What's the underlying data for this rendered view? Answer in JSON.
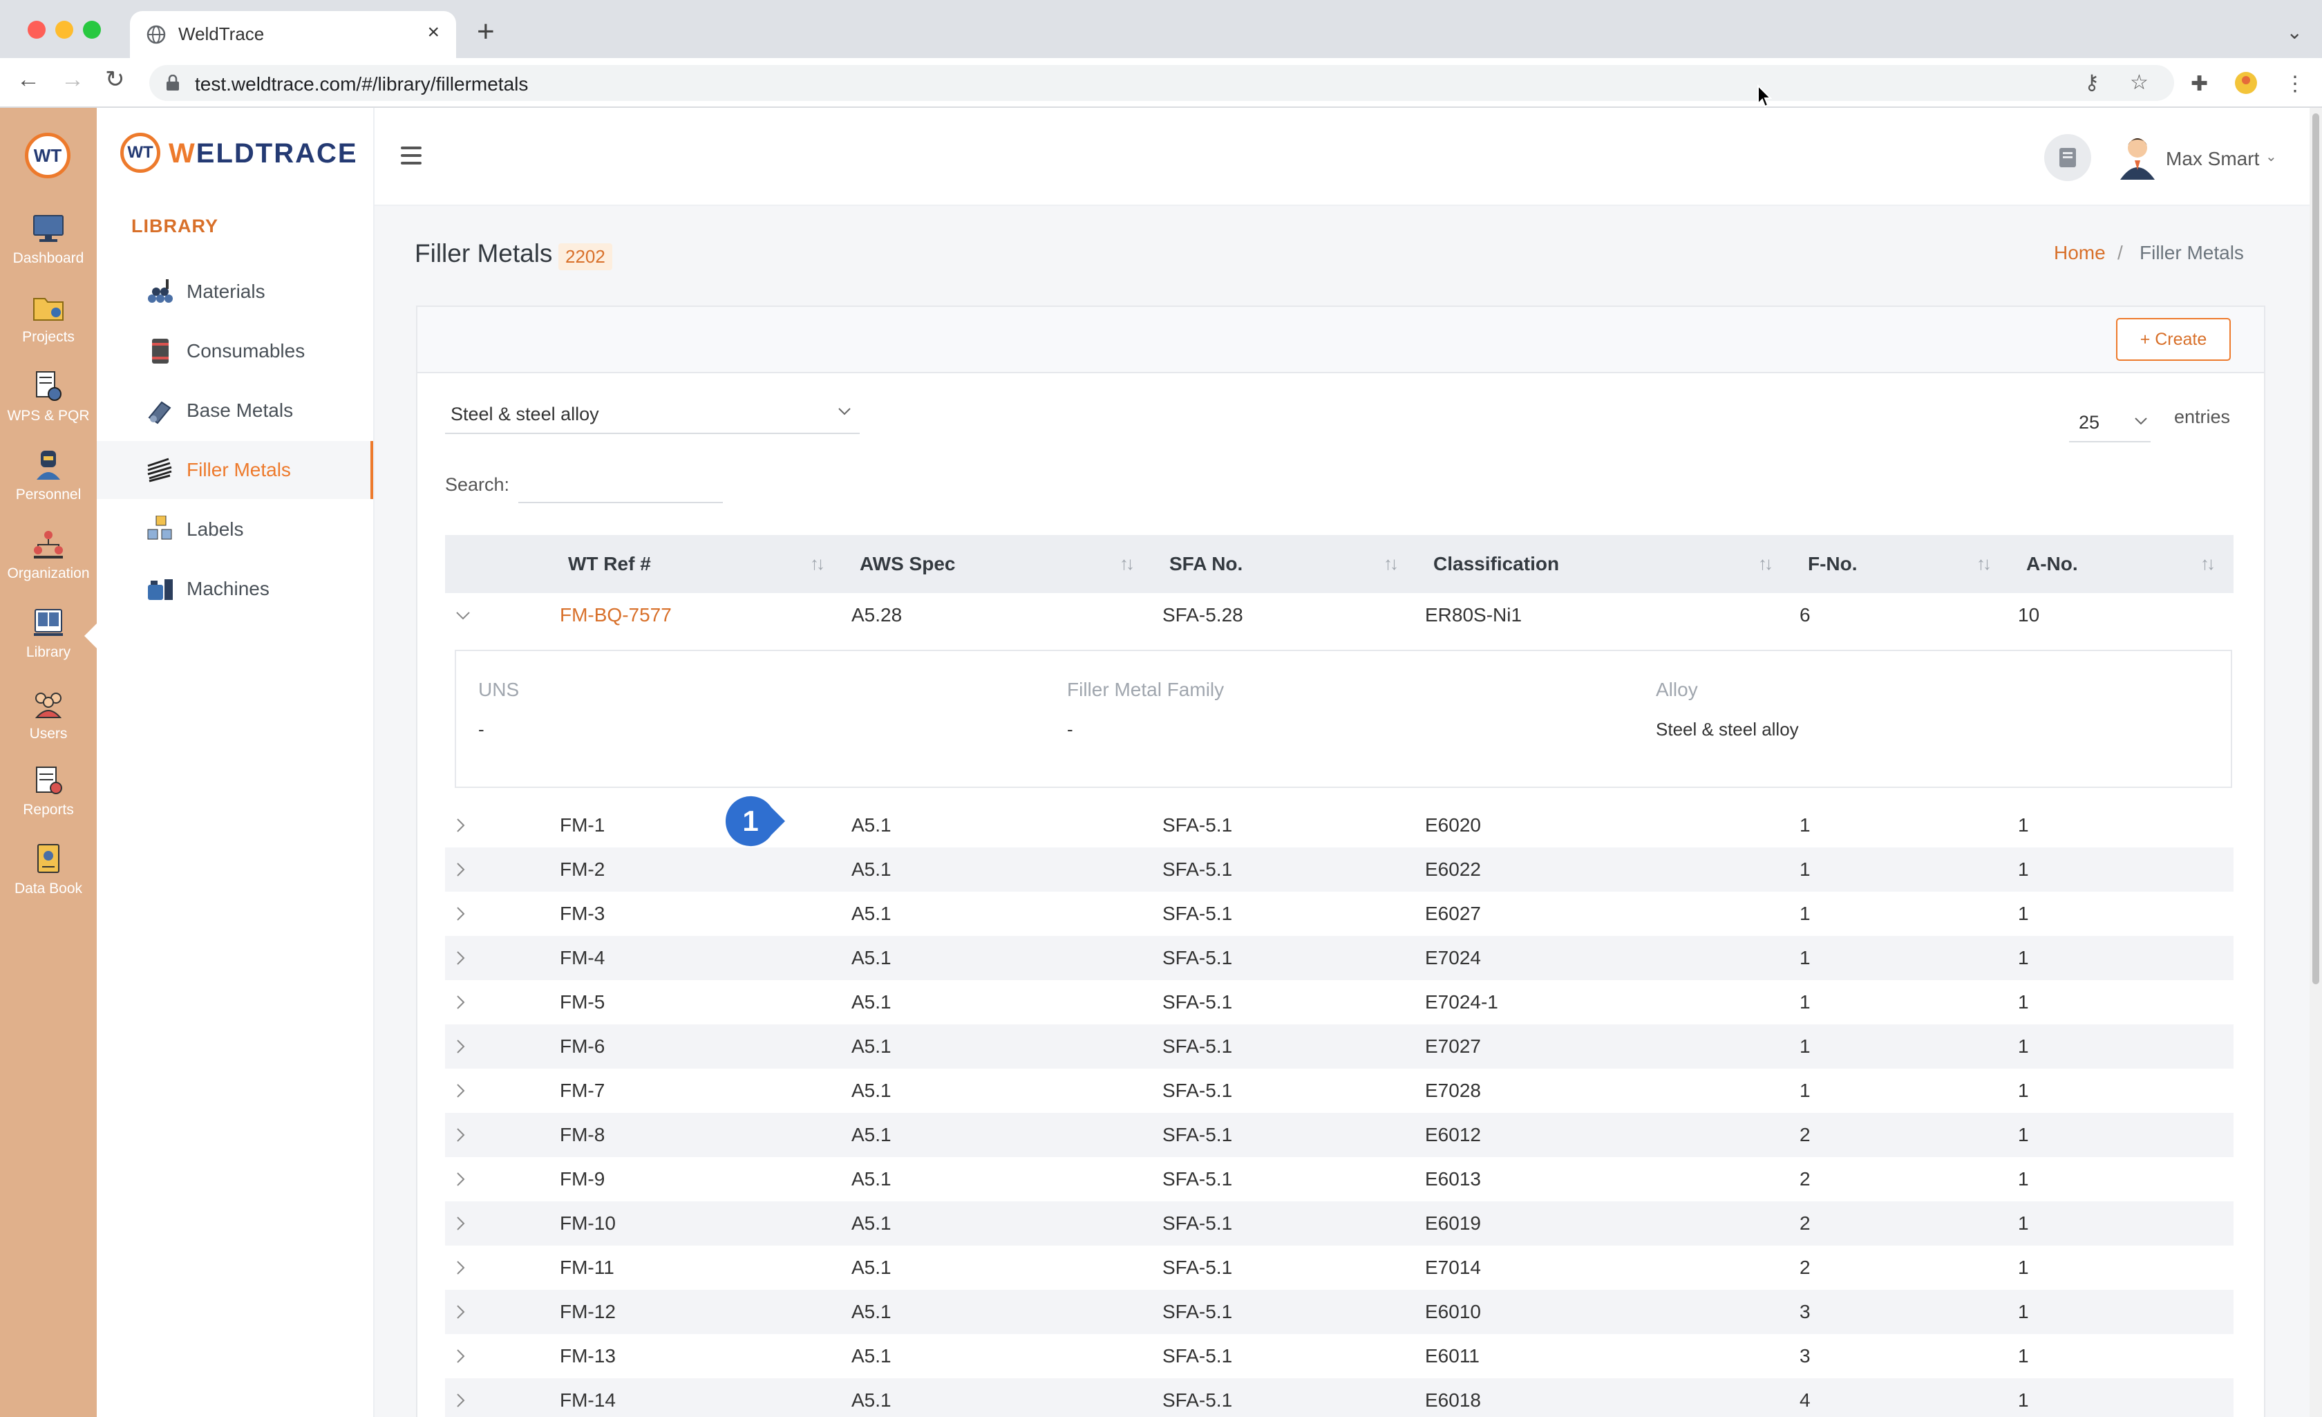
{
  "browser": {
    "tab_title": "WeldTrace",
    "url": "test.weldtrace.com/#/library/fillermetals"
  },
  "rail": {
    "logo": "WT",
    "items": [
      {
        "label": "Dashboard",
        "icon": "monitor-icon"
      },
      {
        "label": "Projects",
        "icon": "folder-icon"
      },
      {
        "label": "WPS & PQR",
        "icon": "document-gear-icon"
      },
      {
        "label": "Personnel",
        "icon": "welder-icon"
      },
      {
        "label": "Organization",
        "icon": "organization-icon"
      },
      {
        "label": "Library",
        "icon": "library-icon"
      },
      {
        "label": "Users",
        "icon": "users-icon"
      },
      {
        "label": "Reports",
        "icon": "report-icon"
      },
      {
        "label": "Data Book",
        "icon": "data-book-icon"
      }
    ]
  },
  "sidebar": {
    "brand_mark": "WT",
    "brand_name_a": "W",
    "brand_name_b": "ELDTRACE",
    "section_title": "LIBRARY",
    "items": [
      {
        "label": "Materials",
        "icon": "materials-icon"
      },
      {
        "label": "Consumables",
        "icon": "consumables-icon"
      },
      {
        "label": "Base Metals",
        "icon": "base-metals-icon"
      },
      {
        "label": "Filler Metals",
        "icon": "filler-metals-icon"
      },
      {
        "label": "Labels",
        "icon": "labels-icon"
      },
      {
        "label": "Machines",
        "icon": "machines-icon"
      }
    ]
  },
  "header": {
    "user_name": "Max Smart"
  },
  "page": {
    "title": "Filler Metals",
    "count": "2202",
    "breadcrumb_home": "Home",
    "breadcrumb_sep": "/",
    "breadcrumb_current": "Filler Metals",
    "create_label": "Create",
    "filter_value": "Steel & steel alloy",
    "entries_value": "25",
    "entries_label": "entries",
    "search_label": "Search:",
    "step_badge": "1"
  },
  "table": {
    "columns": [
      "WT Ref #",
      "AWS Spec",
      "SFA No.",
      "Classification",
      "F-No.",
      "A-No."
    ],
    "expanded_row": {
      "ref": "FM-BQ-7577",
      "aws": "A5.28",
      "sfa": "SFA-5.28",
      "cls": "ER80S-Ni1",
      "f": "6",
      "a": "10"
    },
    "detail": {
      "uns_label": "UNS",
      "uns_value": "-",
      "family_label": "Filler Metal Family",
      "family_value": "-",
      "alloy_label": "Alloy",
      "alloy_value": "Steel & steel alloy"
    },
    "rows": [
      {
        "ref": "FM-1",
        "aws": "A5.1",
        "sfa": "SFA-5.1",
        "cls": "E6020",
        "f": "1",
        "a": "1"
      },
      {
        "ref": "FM-2",
        "aws": "A5.1",
        "sfa": "SFA-5.1",
        "cls": "E6022",
        "f": "1",
        "a": "1"
      },
      {
        "ref": "FM-3",
        "aws": "A5.1",
        "sfa": "SFA-5.1",
        "cls": "E6027",
        "f": "1",
        "a": "1"
      },
      {
        "ref": "FM-4",
        "aws": "A5.1",
        "sfa": "SFA-5.1",
        "cls": "E7024",
        "f": "1",
        "a": "1"
      },
      {
        "ref": "FM-5",
        "aws": "A5.1",
        "sfa": "SFA-5.1",
        "cls": "E7024-1",
        "f": "1",
        "a": "1"
      },
      {
        "ref": "FM-6",
        "aws": "A5.1",
        "sfa": "SFA-5.1",
        "cls": "E7027",
        "f": "1",
        "a": "1"
      },
      {
        "ref": "FM-7",
        "aws": "A5.1",
        "sfa": "SFA-5.1",
        "cls": "E7028",
        "f": "1",
        "a": "1"
      },
      {
        "ref": "FM-8",
        "aws": "A5.1",
        "sfa": "SFA-5.1",
        "cls": "E6012",
        "f": "2",
        "a": "1"
      },
      {
        "ref": "FM-9",
        "aws": "A5.1",
        "sfa": "SFA-5.1",
        "cls": "E6013",
        "f": "2",
        "a": "1"
      },
      {
        "ref": "FM-10",
        "aws": "A5.1",
        "sfa": "SFA-5.1",
        "cls": "E6019",
        "f": "2",
        "a": "1"
      },
      {
        "ref": "FM-11",
        "aws": "A5.1",
        "sfa": "SFA-5.1",
        "cls": "E7014",
        "f": "2",
        "a": "1"
      },
      {
        "ref": "FM-12",
        "aws": "A5.1",
        "sfa": "SFA-5.1",
        "cls": "E6010",
        "f": "3",
        "a": "1"
      },
      {
        "ref": "FM-13",
        "aws": "A5.1",
        "sfa": "SFA-5.1",
        "cls": "E6011",
        "f": "3",
        "a": "1"
      },
      {
        "ref": "FM-14",
        "aws": "A5.1",
        "sfa": "SFA-5.1",
        "cls": "E6018",
        "f": "4",
        "a": "1"
      }
    ]
  },
  "colors": {
    "accent": "#ed7a2c",
    "rail_bg": "#e0b08b",
    "badge": "#2f6fd0"
  }
}
